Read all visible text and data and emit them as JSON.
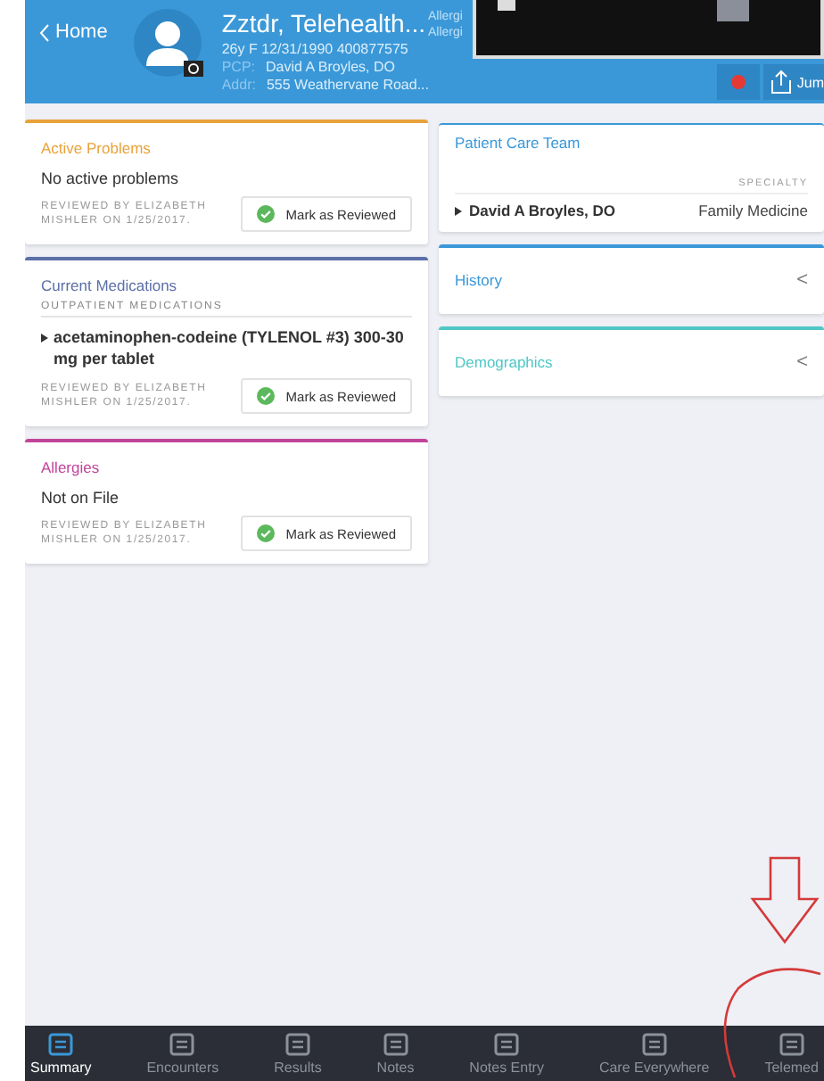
{
  "header": {
    "back": "Home",
    "name": "Zztdr, Telehealth...",
    "demographics": "26y F  12/31/1990  400877575",
    "pcp_label": "PCP:",
    "pcp": "David A Broyles, DO",
    "addr_label": "Addr:",
    "addr": "555 Weathervane Road...",
    "allergy_lines": [
      "Allergi",
      "Allergi"
    ],
    "jump_button": "Jum"
  },
  "left_cards": [
    {
      "kind": "simple",
      "title": "Active Problems",
      "color": "#e8a23a",
      "text": "No active problems",
      "reviewed": "REVIEWED BY ELIZABETH MISHLER ON 1/25/2017.",
      "button": "Mark as Reviewed"
    },
    {
      "kind": "meds",
      "title": "Current Medications",
      "color": "#5b6fa8",
      "subheading": "OUTPATIENT MEDICATIONS",
      "text": "acetaminophen-codeine (TYLENOL #3) 300-30 mg per tablet",
      "reviewed": "REVIEWED BY ELIZABETH MISHLER ON 1/25/2017.",
      "button": "Mark as Reviewed"
    },
    {
      "kind": "simple",
      "title": "Allergies",
      "color": "#c2449a",
      "text": "Not on File",
      "reviewed": "REVIEWED BY ELIZABETH MISHLER ON 1/25/2017.",
      "button": "Mark as Reviewed"
    }
  ],
  "right_cards": [
    {
      "kind": "team",
      "title": "Patient Care Team",
      "color": "#3a98d8",
      "column": "SPECIALTY",
      "member": "David A Broyles, DO",
      "specialty": "Family Medicine"
    },
    {
      "kind": "collapsed",
      "title": "History",
      "color": "#3a98d8",
      "chevron": "<"
    },
    {
      "kind": "collapsed",
      "title": "Demographics",
      "color": "#4fc7c7",
      "chevron": "<"
    }
  ],
  "tabs": [
    {
      "label": "Summary",
      "selected": true
    },
    {
      "label": "Encounters",
      "selected": false
    },
    {
      "label": "Results",
      "selected": false
    },
    {
      "label": "Notes",
      "selected": false
    },
    {
      "label": "Notes Entry",
      "selected": false
    },
    {
      "label": "Care Everywhere",
      "selected": false
    },
    {
      "label": "Telemed",
      "selected": false
    }
  ]
}
